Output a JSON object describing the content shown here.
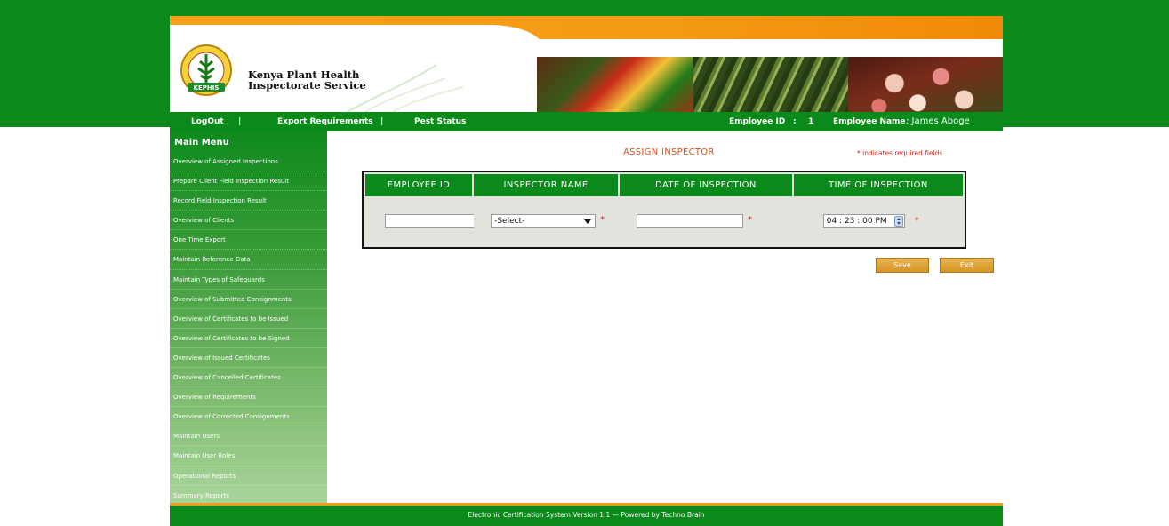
{
  "org": {
    "name_line1": "Kenya Plant Health",
    "name_line2": "Inspectorate Service",
    "logo_text": "KEPHIS"
  },
  "nav": {
    "logout": "LogOut",
    "sep1": "|",
    "export_requirements": "Export Requirements",
    "sep2": "|",
    "pest_status": "Pest Status",
    "employee_id_label": "Employee ID",
    "employee_id_sep": ":",
    "employee_id_value": "1",
    "employee_name_label": "Employee Name",
    "employee_name_value": ": James Aboge"
  },
  "sidebar": {
    "title": "Main Menu",
    "items": [
      "Overview of Assigned Inspections",
      "Prepare Client Field Inspection Result",
      "Record Field Inspection Result",
      "Overview of Clients",
      "One Time Export",
      "Maintain Reference Data",
      "Maintain Types of Safeguards",
      "Overview of Submitted Consignments",
      "Overview of Certificates to be Issued",
      "Overview of Certificates to be Signed",
      "Overview of Issued Certificates",
      "Overview of Cancelled Certificates",
      "Overview of Requirements",
      "Overview of Corrected Consignments",
      "Maintain Users",
      "Maintain User Roles",
      "Operational Reports",
      "Summary Reports"
    ]
  },
  "form": {
    "title": "ASSIGN INSPECTOR",
    "required_note": "* indicates required fields",
    "columns": [
      "EMPLOYEE ID",
      "INSPECTOR NAME",
      "DATE OF INSPECTION",
      "TIME OF INSPECTION"
    ],
    "employee_id_value": "",
    "inspector_selected": "-Select-",
    "date_value": "",
    "time_value": "04 : 23 : 00 PM",
    "required_mark": "*"
  },
  "actions": {
    "save": "Save",
    "exit": "Exit"
  },
  "footer": {
    "text": "Electronic Certification System Version 1.1 — Powered by Techno Brain"
  },
  "colors": {
    "green": "#0a8a1a",
    "orange": "#f59a14",
    "title_orange": "#d2521a",
    "required_red": "#e0251b",
    "button_gold": "#d59424"
  }
}
